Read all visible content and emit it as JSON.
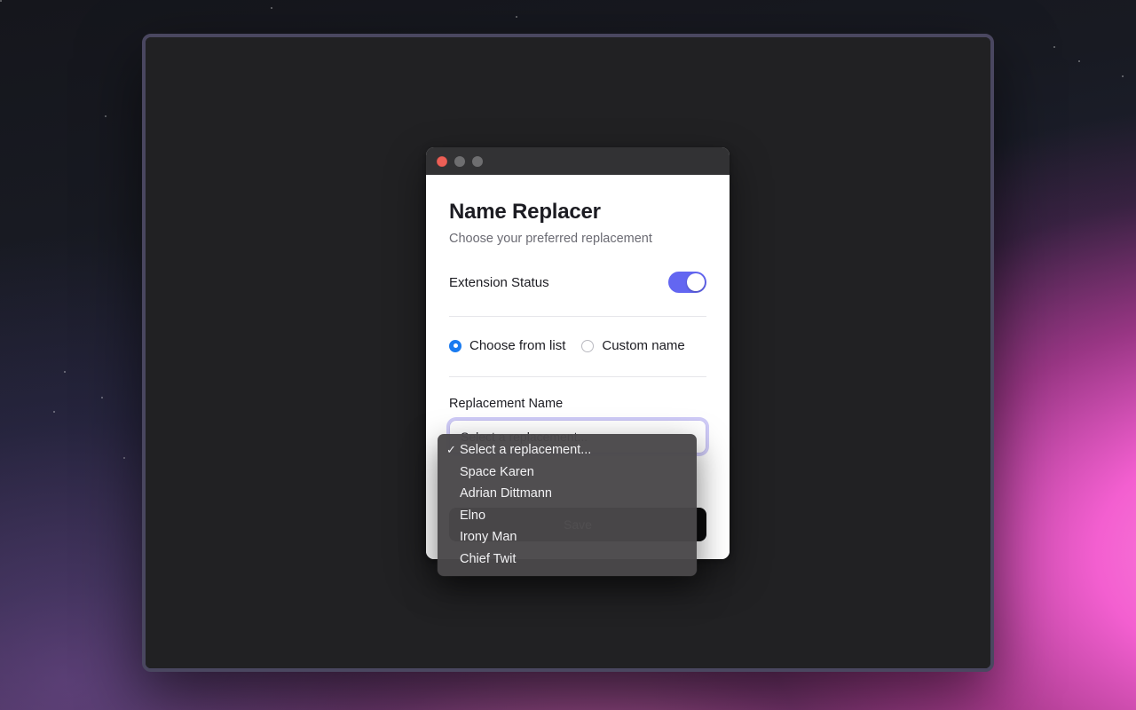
{
  "popup": {
    "titlebar": {
      "close_label": "Close",
      "minimize_label": "Minimize",
      "zoom_label": "Zoom"
    },
    "title": "Name Replacer",
    "subtitle": "Choose your preferred replacement",
    "status": {
      "label": "Extension Status",
      "enabled": true
    },
    "mode_options": [
      {
        "label": "Choose from list",
        "selected": true
      },
      {
        "label": "Custom name",
        "selected": false
      }
    ],
    "field": {
      "label": "Replacement Name",
      "selected_value": "Select a replacement..."
    },
    "save_button_label": "Save"
  },
  "dropdown": {
    "checkmark": "✓",
    "items": [
      {
        "label": "Select a replacement...",
        "checked": true
      },
      {
        "label": "Space Karen",
        "checked": false
      },
      {
        "label": "Adrian Dittmann",
        "checked": false
      },
      {
        "label": "Elno",
        "checked": false
      },
      {
        "label": "Irony Man",
        "checked": false
      },
      {
        "label": "Chief Twit",
        "checked": false
      }
    ]
  },
  "colors": {
    "toggle_on": "#6366f1",
    "radio_accent": "#1a7bf0",
    "focus_ring": "#a7a0f0",
    "traffic_close": "#ec5f56",
    "primary_button_bg": "#0b0b0c"
  }
}
